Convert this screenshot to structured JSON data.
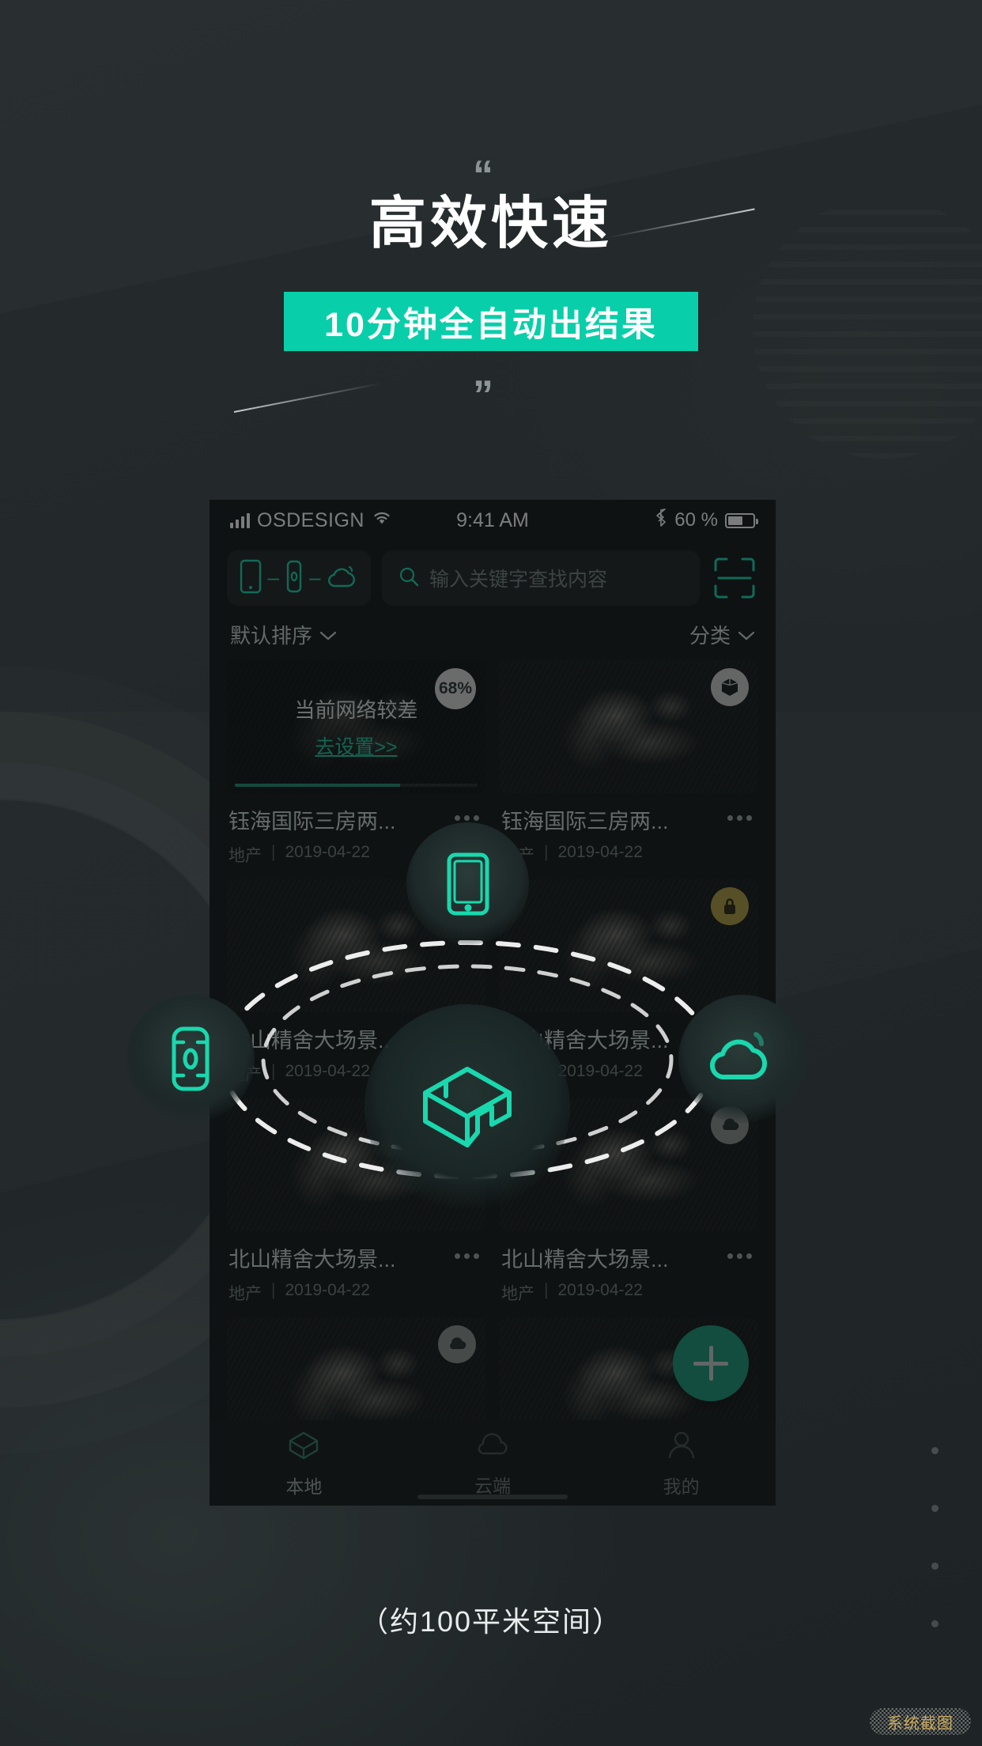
{
  "hero": {
    "quote_open": "“",
    "quote_close": "”",
    "title": "高效快速",
    "banner": "10分钟全自动出结果"
  },
  "caption": "（约100平米空间）",
  "watermark": "系统截图",
  "colors": {
    "accent": "#08cfa9",
    "accent_icon": "#14d6ab",
    "page_bg": "#23292a",
    "phone_bg": "#0e1314",
    "lock_badge": "#b09b3e",
    "fab": "#189477"
  },
  "phone": {
    "statusbar": {
      "carrier": "OSDESIGN",
      "time": "9:41 AM",
      "battery_text": "60 %",
      "signal_icon": "signal-bars-icon",
      "wifi_icon": "wifi-icon",
      "bluetooth_icon": "bluetooth-icon",
      "battery_icon": "battery-icon"
    },
    "toolbar": {
      "device_chain_icon": "phone-scanner-cloud-icon",
      "search_icon": "search-icon",
      "search_value": "",
      "search_placeholder": "输入关键字查找内容",
      "scan_icon": "scan-frame-icon"
    },
    "filters": {
      "sort_label": "默认排序",
      "sort_icon": "chevron-down-icon",
      "category_label": "分类",
      "category_icon": "chevron-down-icon"
    },
    "cards": [
      {
        "title": "钰海国际三房两...",
        "category": "地产",
        "date": "2019-04-22",
        "badge": "68%",
        "badge_type": "percent",
        "overlay_text": "当前网络较差",
        "overlay_link": "去设置>>",
        "progress": "68",
        "more_icon": "more-dots-icon"
      },
      {
        "title": "钰海国际三房两...",
        "category": "地产",
        "date": "2019-04-22",
        "badge_type": "cube",
        "badge_icon": "cube-3d-icon",
        "more_icon": "more-dots-icon"
      },
      {
        "title": "北山精舍大场景...",
        "category": "地产",
        "date": "2019-04-22",
        "badge_type": "none",
        "more_icon": "more-dots-icon"
      },
      {
        "title": "北山精舍大场景...",
        "category": "地产",
        "date": "2019-04-22",
        "badge_type": "lock",
        "badge_icon": "lock-icon",
        "more_icon": "more-dots-icon"
      },
      {
        "title": "北山精舍大场景...",
        "category": "地产",
        "date": "2019-04-22",
        "badge_type": "none",
        "more_icon": "more-dots-icon"
      },
      {
        "title": "北山精舍大场景...",
        "category": "地产",
        "date": "2019-04-22",
        "badge_type": "cloud",
        "badge_icon": "cloud-icon",
        "more_icon": "more-dots-icon"
      },
      {
        "title": "",
        "category": "",
        "date": "",
        "badge_type": "cloud",
        "badge_icon": "cloud-icon",
        "more_icon": "more-dots-icon"
      },
      {
        "title": "",
        "category": "",
        "date": "",
        "badge_type": "none",
        "more_icon": "more-dots-icon"
      }
    ],
    "fab": {
      "icon": "plus-icon",
      "label": "+"
    },
    "tabbar": [
      {
        "label": "本地",
        "icon": "room-3d-icon",
        "active": true
      },
      {
        "label": "云端",
        "icon": "cloud-icon",
        "active": false
      },
      {
        "label": "我的",
        "icon": "person-icon",
        "active": false
      }
    ]
  },
  "orbit": {
    "center_icon": "room-3d-icon",
    "top_icon": "phone-icon",
    "left_icon": "scanner-device-icon",
    "right_icon": "cloud-icon"
  }
}
